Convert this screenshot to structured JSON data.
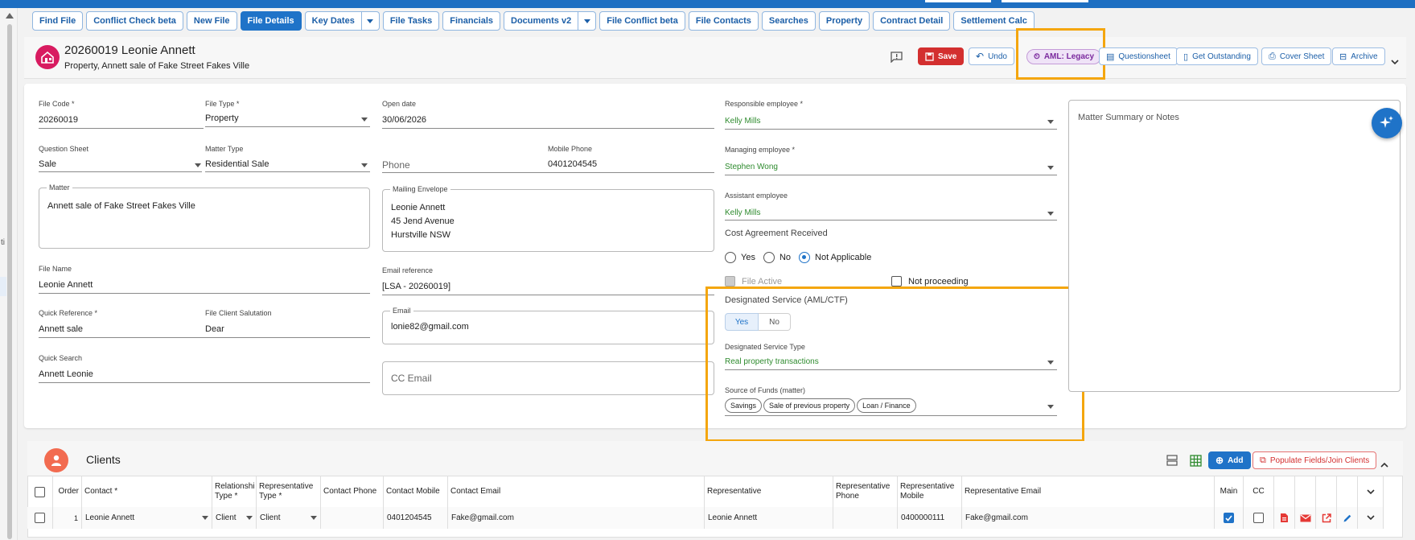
{
  "tabs": [
    {
      "label": "Find File"
    },
    {
      "label": "Conflict Check beta"
    },
    {
      "label": "New File"
    },
    {
      "label": "File Details",
      "active": true
    },
    {
      "label": "Key Dates",
      "dropdown": true
    },
    {
      "label": "File Tasks"
    },
    {
      "label": "Financials"
    },
    {
      "label": "Documents v2",
      "dropdown": true
    },
    {
      "label": "File Conflict beta"
    },
    {
      "label": "File Contacts"
    },
    {
      "label": "Searches"
    },
    {
      "label": "Property"
    },
    {
      "label": "Contract Detail"
    },
    {
      "label": "Settlement Calc"
    }
  ],
  "header": {
    "title": "20260019 Leonie Annett",
    "subtitle": "Property, Annett sale of Fake Street Fakes Ville",
    "actions": {
      "save": "Save",
      "undo": "Undo",
      "aml": "AML: Legacy",
      "questionsheet": "Questionsheet",
      "outstanding": "Get Outstanding",
      "cover": "Cover Sheet",
      "archive": "Archive"
    }
  },
  "form": {
    "file_code_label": "File Code *",
    "file_code": "20260019",
    "file_type_label": "File Type *",
    "file_type": "Property",
    "open_date_label": "Open date",
    "open_date": "30/06/2026",
    "question_sheet_label": "Question Sheet",
    "question_sheet": "Sale",
    "matter_type_label": "Matter Type",
    "matter_type": "Residential Sale",
    "phone_placeholder": "Phone",
    "mobile_label": "Mobile Phone",
    "mobile": "0401204545",
    "matter_label": "Matter",
    "matter": "Annett sale of Fake Street Fakes Ville",
    "mailing_label": "Mailing Envelope",
    "mailing_line1": "Leonie Annett",
    "mailing_line2": "45 Jend Avenue",
    "mailing_line3": "Hurstville NSW",
    "file_name_label": "File Name",
    "file_name": "Leonie Annett",
    "email_ref_label": "Email reference",
    "email_ref": "[LSA - 20260019]",
    "quick_ref_label": "Quick Reference *",
    "quick_ref": "Annett sale",
    "salutation_label": "File Client Salutation",
    "salutation": "Dear",
    "email_label": "Email",
    "email": "lonie82@gmail.com",
    "quick_search_label": "Quick Search",
    "quick_search": "Annett Leonie",
    "cc_email_placeholder": "CC Email",
    "responsible_label": "Responsible employee *",
    "responsible": "Kelly Mills",
    "managing_label": "Managing employee *",
    "managing": "Stephen Wong",
    "assistant_label": "Assistant employee",
    "assistant": "Kelly Mills",
    "cost_agreement_label": "Cost Agreement Received",
    "cost_yes": "Yes",
    "cost_no": "No",
    "cost_na": "Not Applicable",
    "file_active": "File Active",
    "not_proceeding": "Not proceeding",
    "designated_label": "Designated Service (AML/CTF)",
    "designated_yes": "Yes",
    "designated_no": "No",
    "designated_type_label": "Designated Service Type",
    "designated_type": "Real property transactions",
    "source_funds_label": "Source of Funds (matter)",
    "source_funds": [
      "Savings",
      "Sale of previous property",
      "Loan / Finance"
    ],
    "notes_placeholder": "Matter Summary or Notes"
  },
  "clients": {
    "title": "Clients",
    "add": "Add",
    "populate": "Populate Fields/Join Clients",
    "columns": {
      "order": "Order",
      "contact": "Contact *",
      "rel1": "Relationship",
      "rel2": "Type *",
      "rep1": "Representative",
      "rep2": "Type *",
      "phone": "Contact Phone",
      "mobile": "Contact Mobile",
      "email": "Contact Email",
      "representative": "Representative",
      "rep_phone1": "Representative",
      "rep_phone2": "Phone",
      "rep_mobile1": "Representative",
      "rep_mobile2": "Mobile",
      "rep_email": "Representative Email",
      "main": "Main",
      "cc": "CC"
    },
    "row": {
      "order": "1",
      "contact": "Leonie Annett",
      "relationship": "Client",
      "rep_type": "Client",
      "phone": "",
      "mobile": "0401204545",
      "email": "Fake@gmail.com",
      "representative": "Leonie Annett",
      "rep_phone": "",
      "rep_mobile": "0400000111",
      "rep_email": "Fake@gmail.com"
    }
  },
  "colors": {
    "primary": "#1f73c8",
    "danger": "#d32f2f",
    "highlight": "#f4a60e",
    "aml": "#7b2a9e",
    "employee_text": "#2e8b2e"
  }
}
